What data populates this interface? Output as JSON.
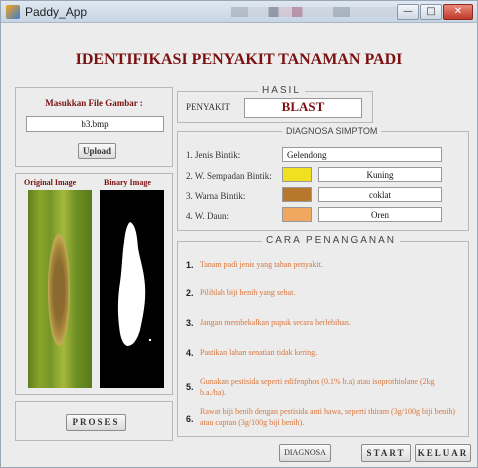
{
  "window": {
    "title": "Paddy_App",
    "min_glyph": "—",
    "max_glyph": "□",
    "close_glyph": "✕"
  },
  "app_title": "IDENTIFIKASI PENYAKIT TANAMAN PADI",
  "file_panel": {
    "label": "Masukkan File Gambar :",
    "filename": "b3.bmp",
    "upload_label": "Upload"
  },
  "images": {
    "original_label": "Original Image",
    "binary_label": "Binary Image"
  },
  "proses_label": "PROSES",
  "hasil": {
    "title": "HASIL",
    "penyakit_label": "PENYAKIT",
    "result": "BLAST"
  },
  "diagnosa": {
    "title": "DIAGNOSA SIMPTOM",
    "rows": [
      {
        "label": "1. Jenis Bintik:",
        "value": "Gelendong"
      },
      {
        "label": "2. W. Sempadan Bintik:",
        "value": "Kuning",
        "color": "#f0e020"
      },
      {
        "label": "3. Warna Bintik:",
        "value": "coklat",
        "color": "#b7782e"
      },
      {
        "label": "4. W. Daun:",
        "value": "Oren",
        "color": "#f0a860"
      }
    ]
  },
  "cara": {
    "title": "CARA PENANGANAN",
    "steps": [
      {
        "num": "1.",
        "text": "Tanam padi jenis yang tahan penyakit."
      },
      {
        "num": "2.",
        "text": "Pilihlah biji benih yang sehat."
      },
      {
        "num": "3.",
        "text": "Jangan membekalkan pupuk secara berlebihan."
      },
      {
        "num": "4.",
        "text": "Pastikan lahan senatian tidak kering."
      },
      {
        "num": "5.",
        "text": "Gunakan pestisida seperti edifenphos (0.1% b.a) atau isoprothiolane (2kg b.a./ha)."
      },
      {
        "num": "6.",
        "text": "Rawat biji benih dengan pestisida anti hawa, seperti thiram (3g/100g biji benih) atau captan (3g/100g biji benih)."
      }
    ]
  },
  "buttons": {
    "diagnosa": "DIAGNOSA",
    "start": "START",
    "keluar": "KELUAR"
  }
}
